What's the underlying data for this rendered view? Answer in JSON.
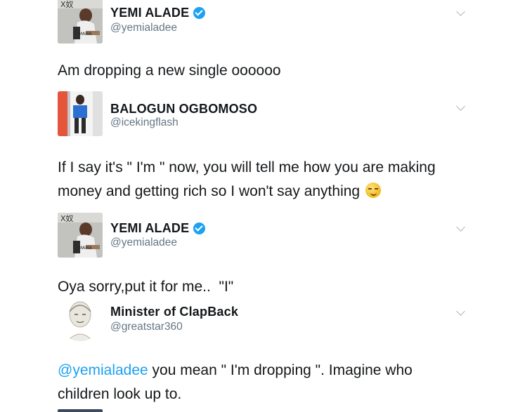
{
  "tweets": [
    {
      "display_name": "YEMI ALADE",
      "handle": "@yemialadee",
      "verified": true,
      "avatar": "yemi-alade-album-cover",
      "text": "Am dropping a new single oooooo"
    },
    {
      "display_name": "BALOGUN OGBOMOSO",
      "handle": "@icekingflash",
      "verified": false,
      "avatar": "man-in-blue-shirt",
      "text": "If I say it's \" I'm \" now, you will tell me how you are making money and getting rich so I won't say anything",
      "emoji": "smirk-emoji"
    },
    {
      "display_name": "YEMI ALADE",
      "handle": "@yemialadee",
      "verified": true,
      "avatar": "yemi-alade-album-cover",
      "text": "Oya sorry,put it for me..  \"I\""
    },
    {
      "display_name": "Minister of ClapBack",
      "handle": "@greatstar360",
      "verified": false,
      "avatar": "sketch-portrait",
      "mention": "@yemialadee",
      "text": " you mean \" I'm dropping \". Imagine who children look up to."
    }
  ],
  "colors": {
    "accent": "#1da1f2",
    "handle": "#657786",
    "text": "#14171a"
  }
}
